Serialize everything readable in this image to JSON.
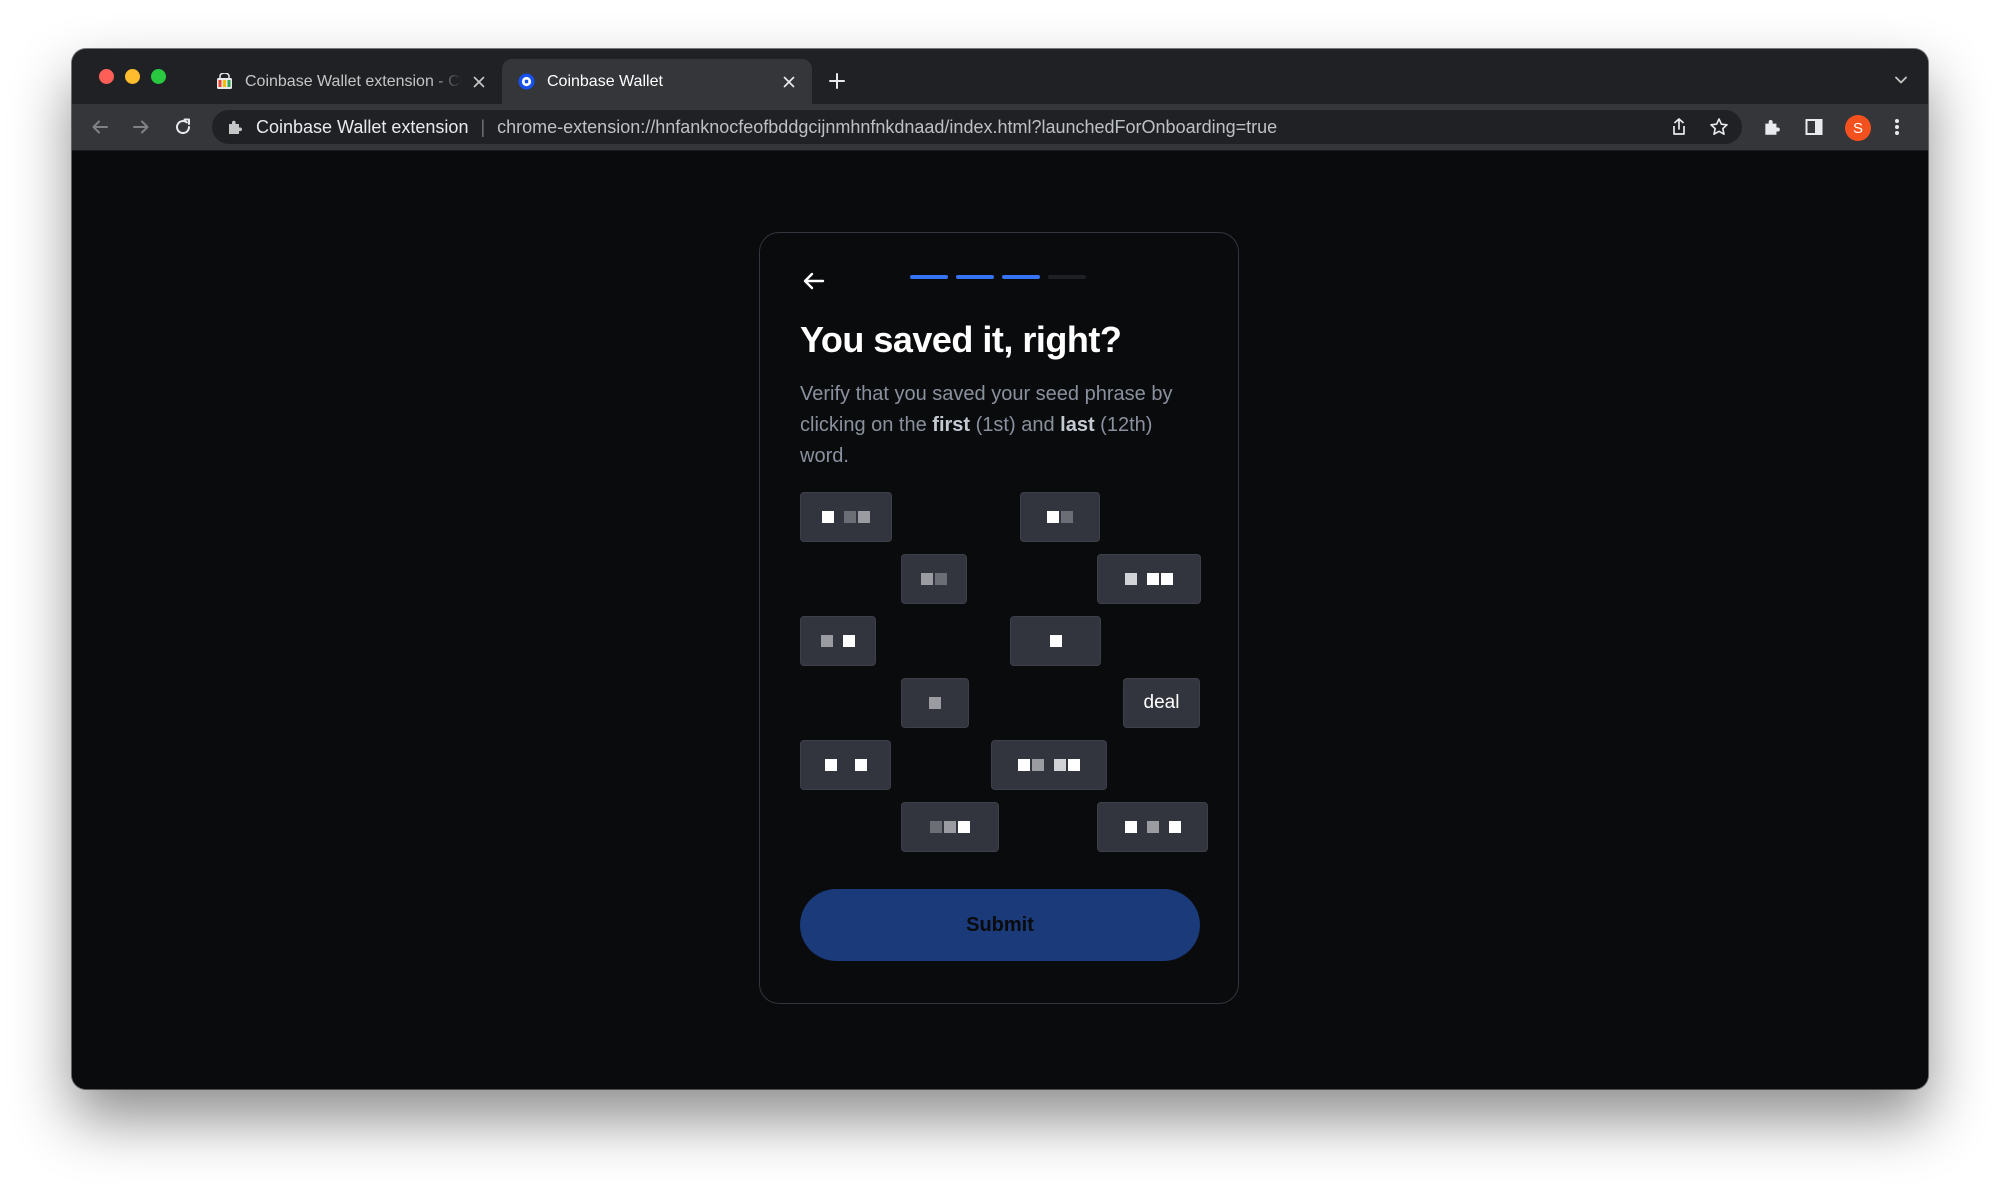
{
  "browser": {
    "tabs": [
      {
        "title": "Coinbase Wallet extension - Chrome Web Store",
        "active": false
      },
      {
        "title": "Coinbase Wallet",
        "active": true
      }
    ],
    "omnibox": {
      "origin": "Coinbase Wallet extension",
      "url": "chrome-extension://hnfanknocfeofbddgcijnmhnfnkdnaad/index.html?launchedForOnboarding=true"
    },
    "profile_initial": "S",
    "icons": [
      "back-icon",
      "forward-icon",
      "reload-icon",
      "puzzle-icon",
      "share-icon",
      "star-icon",
      "side-panel-icon",
      "kebab-menu-icon",
      "chevron-down-icon",
      "plus-icon",
      "close-icon"
    ]
  },
  "onboarding": {
    "progress": {
      "completed_steps": 3,
      "total_steps": 4
    },
    "title": "You saved it, right?",
    "description": {
      "part1": "Verify that you saved your seed phrase by clicking on the ",
      "first": "first",
      "part2": " (1st) and ",
      "last": "last",
      "part3": " (12th) word."
    },
    "words": [
      {
        "text": "",
        "obscured": true
      },
      {
        "text": "",
        "obscured": true
      },
      {
        "text": "",
        "obscured": true
      },
      {
        "text": "",
        "obscured": true
      },
      {
        "text": "",
        "obscured": true
      },
      {
        "text": "",
        "obscured": true
      },
      {
        "text": "",
        "obscured": true
      },
      {
        "text": "deal",
        "obscured": false
      },
      {
        "text": "",
        "obscured": true
      },
      {
        "text": "",
        "obscured": true
      },
      {
        "text": "",
        "obscured": true
      },
      {
        "text": "",
        "obscured": true
      }
    ],
    "submit_label": "Submit"
  },
  "colors": {
    "page_bg": "#0a0b0d",
    "card_border": "#32353d",
    "word_chip_bg": "#32353d",
    "progress_active": "#3773f5",
    "submit_bg": "#1a3a7a"
  }
}
